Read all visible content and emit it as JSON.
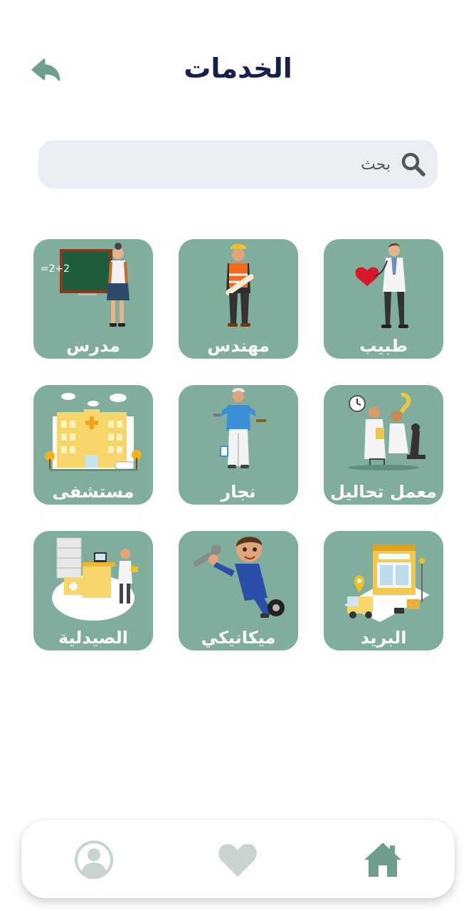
{
  "header": {
    "title": "الخدمات"
  },
  "search": {
    "placeholder": "بحث"
  },
  "services": [
    {
      "label": "طبيب",
      "icon": "doctor-illustration"
    },
    {
      "label": "مهندس",
      "icon": "engineer-illustration"
    },
    {
      "label": "مدرس",
      "icon": "teacher-illustration"
    },
    {
      "label": "معمل تحاليل",
      "icon": "lab-illustration"
    },
    {
      "label": "نجار",
      "icon": "carpenter-illustration"
    },
    {
      "label": "مستشفى",
      "icon": "hospital-illustration"
    },
    {
      "label": "البريد",
      "icon": "post-office-illustration"
    },
    {
      "label": "ميكانيكي",
      "icon": "mechanic-illustration"
    },
    {
      "label": "الصيدلية",
      "icon": "pharmacy-illustration"
    }
  ],
  "teacher_board": {
    "text": "2+2=?"
  },
  "bottom_nav": {
    "items": [
      "home-icon",
      "heart-icon",
      "profile-icon"
    ]
  },
  "colors": {
    "accent": "#80ad9c",
    "title": "#16204a",
    "search_bg": "#eaeef2",
    "nav_inactive": "#c9d4d0"
  }
}
